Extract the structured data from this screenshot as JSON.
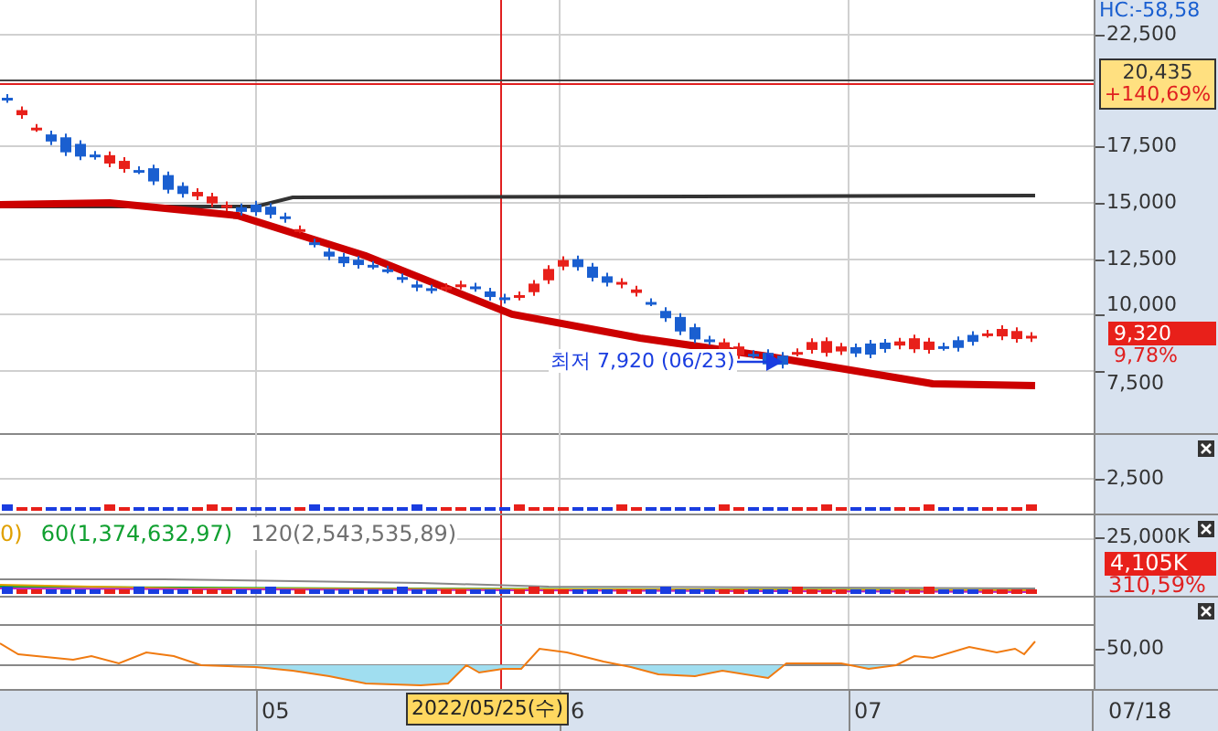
{
  "main_pane": {
    "header": "HC:-58,58",
    "y_ticks": [
      "22,500",
      "17,500",
      "15,000",
      "12,500",
      "10,000",
      "7,500"
    ],
    "high_tag": {
      "price": "20,435",
      "change": "+140,69%"
    },
    "last_tag": {
      "price": "9,320",
      "change": "9,78%"
    },
    "low_annotation": "최저 7,920 (06/23)"
  },
  "volume_pane": {
    "y_ticks": [
      "2,500"
    ]
  },
  "volume_ma_pane": {
    "legend": [
      {
        "text": "0)",
        "color": "#e0a000"
      },
      {
        "text": "60(1,374,632,97)",
        "color": "#10a030"
      },
      {
        "text": "120(2,543,535,89)",
        "color": "#707070"
      }
    ],
    "y_ticks": [
      "25,000K"
    ],
    "last_tag": {
      "value": "4,105K",
      "change": "310,59%"
    }
  },
  "indicator_pane": {
    "y_ticks": [
      "50,00"
    ]
  },
  "x_axis": {
    "labels": [
      "05",
      "6",
      "07"
    ],
    "crosshair_date": "2022/05/25(수)",
    "last_date": "07/18"
  }
}
